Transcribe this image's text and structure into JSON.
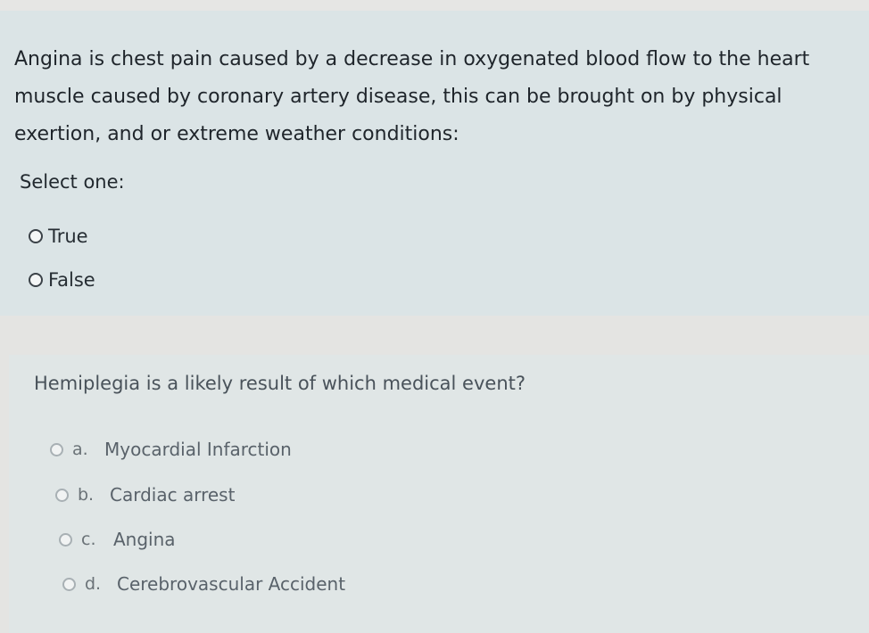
{
  "question1": {
    "text": "Angina is chest pain caused by a decrease in oxygenated blood flow to the heart muscle caused by coronary artery disease, this can be brought on by physical exertion, and or extreme weather conditions:",
    "select_label": "Select one:",
    "options": [
      {
        "label": "True"
      },
      {
        "label": "False"
      }
    ]
  },
  "question2": {
    "text": "Hemiplegia is a likely result of which medical event?",
    "options": [
      {
        "letter": "a.",
        "label": "Myocardial Infarction"
      },
      {
        "letter": "b.",
        "label": "Cardiac arrest"
      },
      {
        "letter": "c.",
        "label": "Angina"
      },
      {
        "letter": "d.",
        "label": "Cerebrovascular Accident"
      }
    ]
  }
}
